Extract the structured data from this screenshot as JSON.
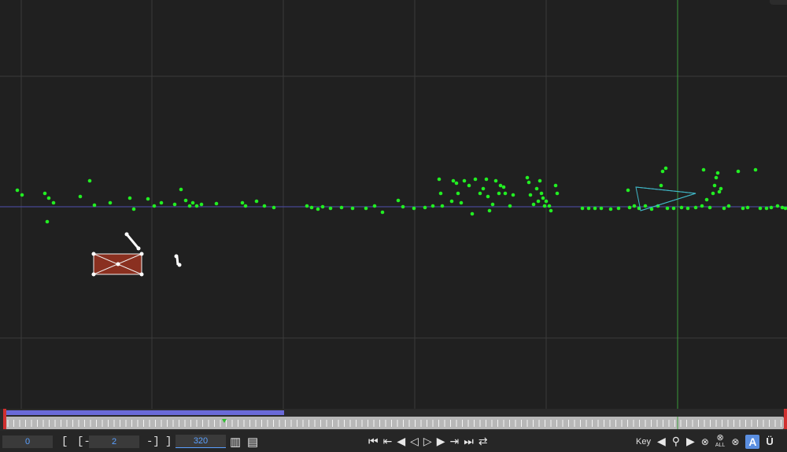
{
  "viewport": {
    "name": "3D viewport",
    "grid_color": "#3a3a3a",
    "point_color": "#22ee22",
    "horizon_color": "#5050b0",
    "playhead_color": "#3a9a3a",
    "camera_color": "#40b8c8",
    "selected_box_color": "#8a3020"
  },
  "timeline": {
    "range_color": "#6a6ad8"
  },
  "controls": {
    "start_frame": "0",
    "step_value": "2",
    "end_frame": "320",
    "bracket_open": "[",
    "bracket_minus_open": "[-",
    "bracket_minus_close": "-]",
    "bracket_close": "]",
    "key_label": "Key",
    "autokey_label": "A",
    "all_label": "ALL",
    "last_icon_label": "Ü"
  }
}
